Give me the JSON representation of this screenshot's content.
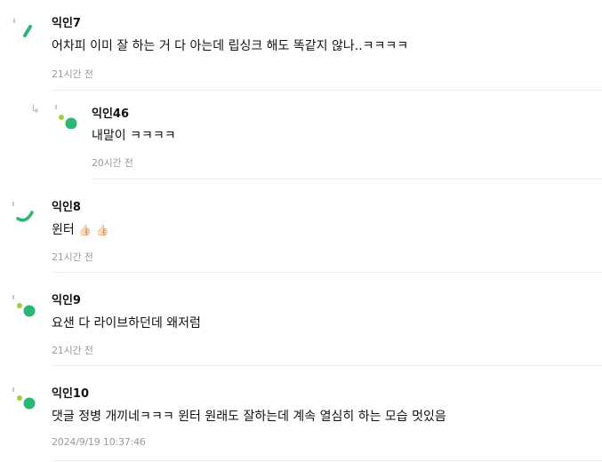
{
  "comments": [
    {
      "author": "익인7",
      "text": "어차피 이미 잘 하는 거 다 아는데 립싱크 해도 똑같지 않나..ㅋㅋㅋㅋ",
      "time": "21시간 전",
      "avatar_icon": "green-slash-avatar-icon",
      "is_reply": false
    },
    {
      "author": "익인46",
      "text": "내말이 ㅋㅋㅋㅋ",
      "time": "20시간 전",
      "avatar_icon": "green-dots-avatar-icon",
      "is_reply": true
    },
    {
      "author": "익인8",
      "text_prefix": "윈터",
      "emojis": [
        "👍🏻",
        "👍🏻"
      ],
      "time": "21시간 전",
      "avatar_icon": "green-arc-avatar-icon",
      "is_reply": false
    },
    {
      "author": "익인9",
      "text": "요샌 다 라이브하던데 왜저럼",
      "time": "21시간 전",
      "avatar_icon": "green-dots-avatar-icon",
      "is_reply": false
    },
    {
      "author": "익인10",
      "text": "댓글 정병 개끼네ㅋㅋㅋ 윈터 원래도 잘하는데 계속 열심히 하는 모습 멋있음",
      "time": "2024/9/19 10:37:46",
      "avatar_icon": "green-dots-avatar-icon",
      "is_reply": false
    }
  ],
  "reply_icon": "reply-arrow-icon",
  "colors": {
    "avatar_green": "#2bb673",
    "avatar_lime": "#9ad23b",
    "avatar_dot_gray": "#c7c7c7",
    "time_gray": "#999999",
    "divider": "#eeeeee"
  }
}
